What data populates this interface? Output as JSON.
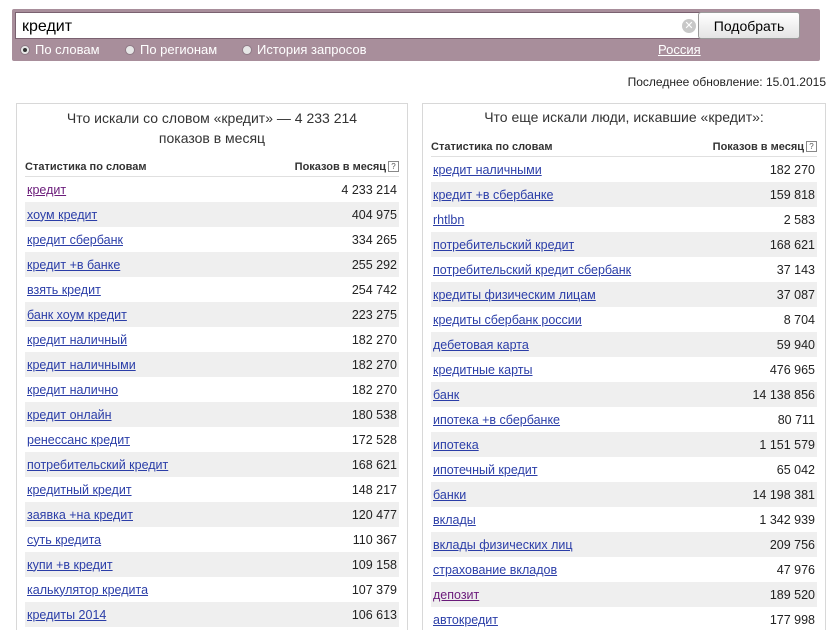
{
  "search": {
    "query": "кредит",
    "clear_symbol": "✕",
    "submit_label": "Подобрать"
  },
  "modes": [
    {
      "label": "По словам",
      "checked": true
    },
    {
      "label": "По регионам",
      "checked": false
    },
    {
      "label": "История запросов",
      "checked": false
    }
  ],
  "region": "Россия",
  "last_update": "Последнее обновление: 15.01.2015",
  "left": {
    "title": "Что искали со словом «кредит» — 4 233 214 показов в месяц",
    "col_query": "Статистика по словам",
    "col_count": "Показов в месяц",
    "help_symbol": "?",
    "rows": [
      {
        "q": "кредит",
        "n": "4 233 214",
        "visited": true
      },
      {
        "q": "хоум кредит",
        "n": "404 975"
      },
      {
        "q": "кредит сбербанк",
        "n": "334 265"
      },
      {
        "q": "кредит +в банке",
        "n": "255 292"
      },
      {
        "q": "взять кредит",
        "n": "254 742"
      },
      {
        "q": "банк хоум кредит",
        "n": "223 275"
      },
      {
        "q": "кредит наличный",
        "n": "182 270"
      },
      {
        "q": "кредит наличными",
        "n": "182 270"
      },
      {
        "q": "кредит налично",
        "n": "182 270"
      },
      {
        "q": "кредит онлайн",
        "n": "180 538"
      },
      {
        "q": "ренессанс кредит",
        "n": "172 528"
      },
      {
        "q": "потребительский кредит",
        "n": "168 621"
      },
      {
        "q": "кредитный кредит",
        "n": "148 217"
      },
      {
        "q": "заявка +на кредит",
        "n": "120 477"
      },
      {
        "q": "суть кредита",
        "n": "110 367"
      },
      {
        "q": "купи +в кредит",
        "n": "109 158"
      },
      {
        "q": "калькулятор кредита",
        "n": "107 379"
      },
      {
        "q": "кредиты 2014",
        "n": "106 613"
      }
    ]
  },
  "right": {
    "title": "Что еще искали люди, искавшие «кредит»:",
    "col_query": "Статистика по словам",
    "col_count": "Показов в месяц",
    "help_symbol": "?",
    "rows": [
      {
        "q": "кредит наличными",
        "n": "182 270"
      },
      {
        "q": "кредит +в сбербанке",
        "n": "159 818"
      },
      {
        "q": "rhtlbn",
        "n": "2 583"
      },
      {
        "q": "потребительский кредит",
        "n": "168 621"
      },
      {
        "q": "потребительский кредит сбербанк",
        "n": "37 143"
      },
      {
        "q": "кредиты физическим лицам",
        "n": "37 087"
      },
      {
        "q": "кредиты сбербанк россии",
        "n": "8 704"
      },
      {
        "q": "дебетовая карта",
        "n": "59 940"
      },
      {
        "q": "кредитные карты",
        "n": "476 965"
      },
      {
        "q": "банк",
        "n": "14 138 856"
      },
      {
        "q": "ипотека +в сбербанке",
        "n": "80 711"
      },
      {
        "q": "ипотека",
        "n": "1 151 579"
      },
      {
        "q": "ипотечный кредит",
        "n": "65 042"
      },
      {
        "q": "банки",
        "n": "14 198 381"
      },
      {
        "q": "вклады",
        "n": "1 342 939"
      },
      {
        "q": "вклады физических лиц",
        "n": "209 756"
      },
      {
        "q": "страхование вкладов",
        "n": "47 976"
      },
      {
        "q": "депозит",
        "n": "189 520",
        "visited": true
      },
      {
        "q": "автокредит",
        "n": "177 998"
      }
    ]
  }
}
